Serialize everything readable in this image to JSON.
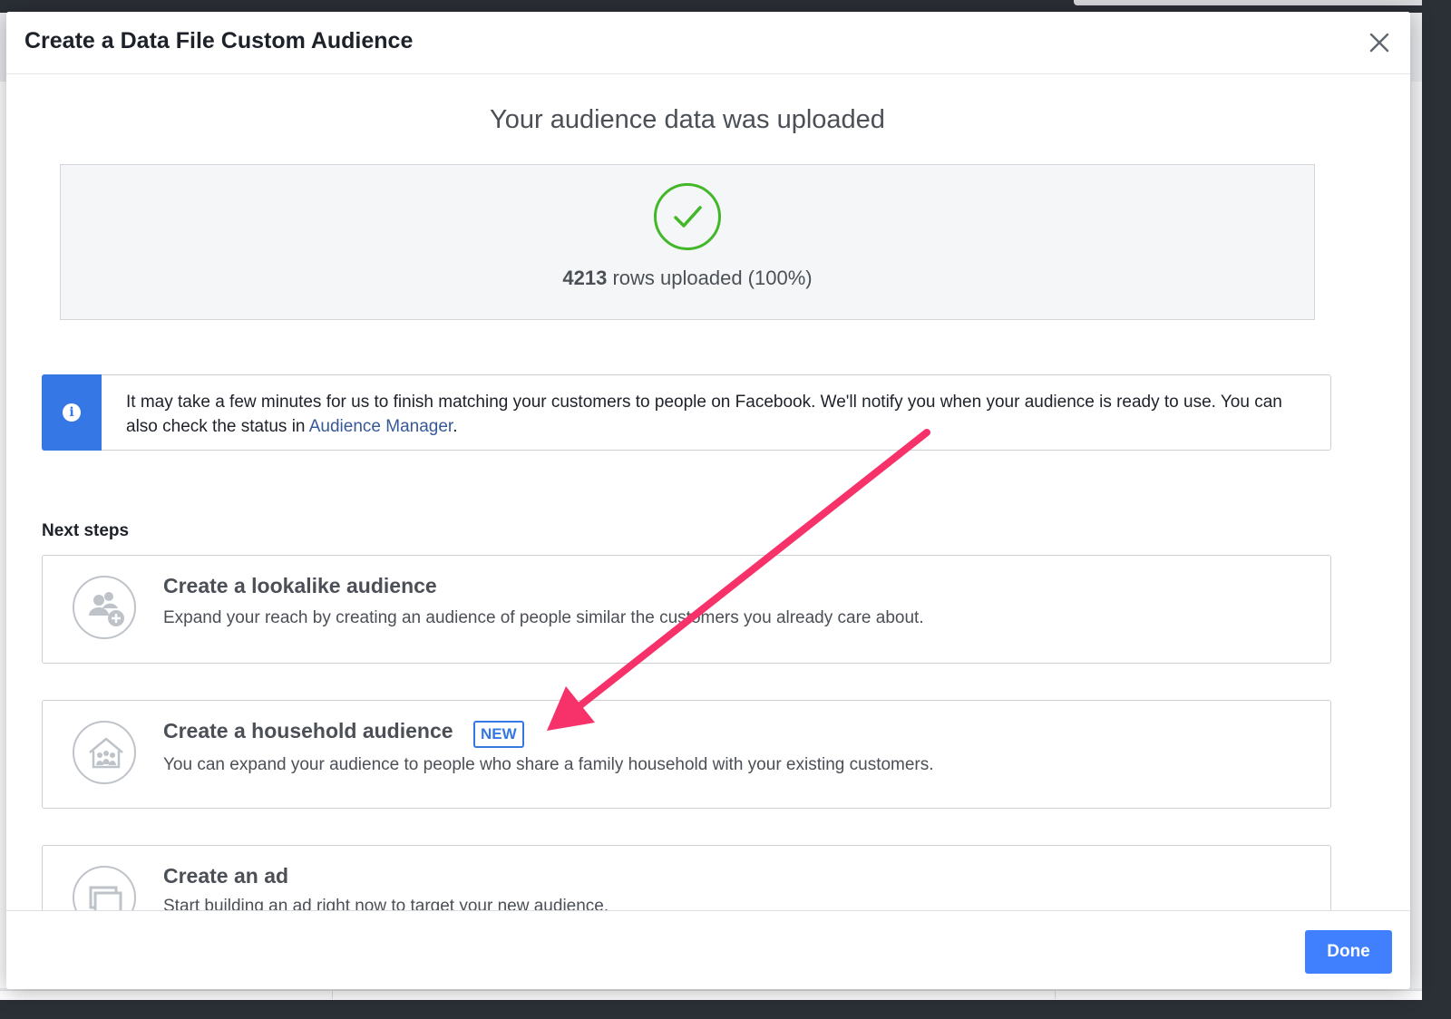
{
  "modal": {
    "title": "Create a Data File Custom Audience"
  },
  "upload": {
    "heading": "Your audience data was uploaded",
    "rows_count": "4213",
    "rows_suffix": " rows uploaded (100%)",
    "percent_complete": 100,
    "status_color": "#42b72a"
  },
  "info_banner": {
    "text": "It may take a few minutes for us to finish matching your customers to people on Facebook. We'll notify you when your audience is ready to use. You can also check the status in ",
    "link_text": "Audience Manager",
    "trailing": ".",
    "icon": "info-icon",
    "accent_color": "#3578e5"
  },
  "next_steps": {
    "label": "Next steps",
    "items": [
      {
        "title": "Create a lookalike audience",
        "description": "Expand your reach by creating an audience of people similar the customers you already care about.",
        "icon": "lookalike-audience-icon"
      },
      {
        "title": "Create a household audience",
        "badge": "NEW",
        "description": "You can expand your audience to people who share a family household with your existing customers.",
        "icon": "household-icon"
      },
      {
        "title": "Create an ad",
        "description": "Start building an ad right now to target your new audience.",
        "icon": "create-ad-icon"
      }
    ]
  },
  "footer": {
    "done_label": "Done",
    "done_color": "#4080ff"
  },
  "annotation": {
    "arrow_color": "#f7316a"
  }
}
